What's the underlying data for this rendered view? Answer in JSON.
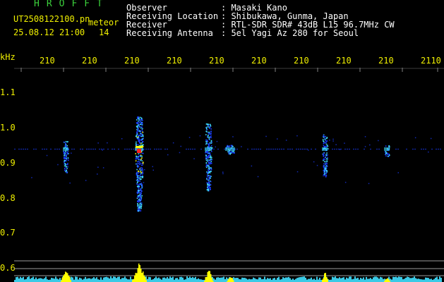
{
  "header": {
    "brand": "HROFFT",
    "filename": "UT2508122100.pn",
    "mode": "meteor",
    "timestamp": "25.08.12 21:00",
    "count": "14",
    "info": [
      {
        "label": "Observer",
        "value": ": Masaki Kano"
      },
      {
        "label": "Receiving Location",
        "value": ": Shibukawa, Gunma, Japan"
      },
      {
        "label": "Receiver",
        "value": ": RTL-SDR SDR# 43dB L15 96.7MHz CW"
      },
      {
        "label": "Receiving Antenna",
        "value": ": 5el Yagi Az 280 for Seoul"
      }
    ]
  },
  "axes": {
    "y_unit": "kHz",
    "x_ticks": [
      "210",
      "210",
      "210",
      "210",
      "210",
      "210",
      "210",
      "210",
      "210",
      "2110"
    ],
    "y_ticks": [
      "1.1",
      "1.0",
      "0.9",
      "0.8",
      "0.7",
      "0.6"
    ]
  },
  "colors": {
    "background": "#000000",
    "text": "#ffffff",
    "brand": "#3cd23c",
    "ticks": "#f0f000",
    "signal_low": "#1a3cff",
    "signal_mid": "#40e0ff",
    "signal_high": "#ffff00",
    "signal_peak": "#ff2020",
    "level_bars": "#ffff00",
    "baseline": "#40e0ff"
  }
}
